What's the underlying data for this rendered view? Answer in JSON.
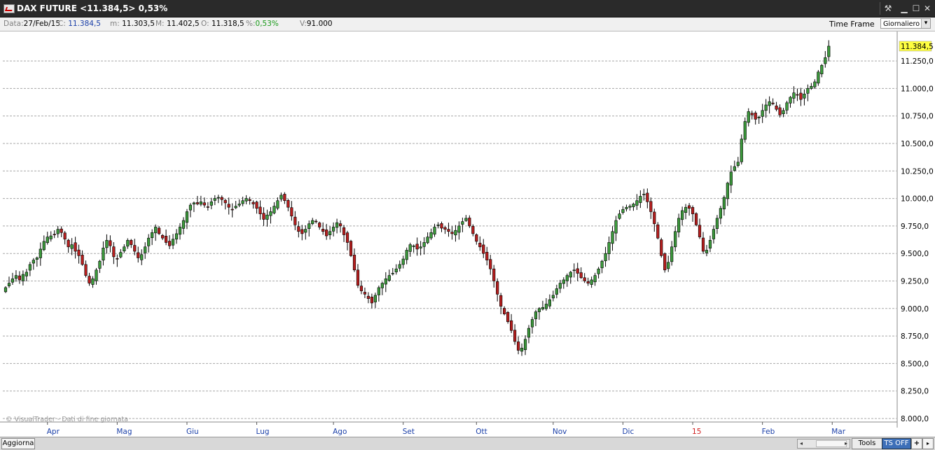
{
  "window": {
    "title": "DAX FUTURE <11.384,5> 0,53%",
    "wrench_icon": "wrench-icon",
    "min_icon": "minimize-icon",
    "max_icon": "maximize-icon",
    "close_icon": "close-icon",
    "wrench_glyph": "⚒",
    "min_glyph": "▁",
    "max_glyph": "☐",
    "close_glyph": "✕"
  },
  "infobar": {
    "data_label": "Data:",
    "data_value": "27/Feb/15",
    "close_label": "C:",
    "close_value": "11.384,5",
    "min_label": "m:",
    "min_value": "11.303,5",
    "max_label": "M:",
    "max_value": "11.402,5",
    "open_label": "O:",
    "open_value": "11.318,5",
    "pct_label": "%:",
    "pct_value": "0,53%",
    "vol_label": "V:",
    "vol_value": "91.000",
    "timeframe_label": "Time Frame",
    "timeframe_value": "Giornaliero",
    "dropdown_glyph": "▾"
  },
  "chart_data": {
    "type": "candlestick",
    "title": "DAX FUTURE",
    "ylim": [
      8000,
      11400
    ],
    "y_ticks": [
      "8.000,0",
      "8.250,0",
      "8.500,0",
      "8.750,0",
      "9.000,0",
      "9.250,0",
      "9.500,0",
      "9.750,0",
      "10.000,0",
      "10.250,0",
      "10.500,0",
      "10.750,0",
      "11.000,0",
      "11.250,0"
    ],
    "y_tick_values": [
      8000,
      8250,
      8500,
      8750,
      9000,
      9250,
      9500,
      9750,
      10000,
      10250,
      10500,
      10750,
      11000,
      11250
    ],
    "last_price_label": "11.384,5",
    "last_price": 11384.5,
    "x_months": [
      {
        "label": "Apr",
        "index": 12,
        "highlight": false
      },
      {
        "label": "Mag",
        "index": 32,
        "highlight": false
      },
      {
        "label": "Giu",
        "index": 52,
        "highlight": false
      },
      {
        "label": "Lug",
        "index": 72,
        "highlight": false
      },
      {
        "label": "Ago",
        "index": 94,
        "highlight": false
      },
      {
        "label": "Set",
        "index": 114,
        "highlight": false
      },
      {
        "label": "Ott",
        "index": 135,
        "highlight": false
      },
      {
        "label": "Nov",
        "index": 157,
        "highlight": false
      },
      {
        "label": "Dic",
        "index": 177,
        "highlight": false
      },
      {
        "label": "15",
        "index": 197,
        "highlight": true
      },
      {
        "label": "Feb",
        "index": 217,
        "highlight": false
      },
      {
        "label": "Mar",
        "index": 237,
        "highlight": false
      }
    ],
    "closes": [
      9190,
      9230,
      9270,
      9300,
      9260,
      9310,
      9330,
      9400,
      9440,
      9460,
      9540,
      9610,
      9650,
      9660,
      9670,
      9720,
      9690,
      9630,
      9560,
      9580,
      9520,
      9480,
      9400,
      9300,
      9230,
      9270,
      9350,
      9430,
      9550,
      9620,
      9570,
      9470,
      9450,
      9510,
      9560,
      9620,
      9580,
      9520,
      9460,
      9490,
      9560,
      9640,
      9690,
      9740,
      9680,
      9640,
      9600,
      9570,
      9630,
      9680,
      9740,
      9800,
      9880,
      9940,
      9960,
      9950,
      9970,
      9940,
      9920,
      9970,
      10000,
      10010,
      9990,
      9960,
      9920,
      9900,
      9930,
      9950,
      9980,
      10000,
      9980,
      9950,
      9910,
      9860,
      9810,
      9850,
      9880,
      9930,
      9980,
      10030,
      9980,
      9920,
      9840,
      9760,
      9700,
      9680,
      9720,
      9770,
      9800,
      9790,
      9740,
      9700,
      9660,
      9700,
      9740,
      9780,
      9750,
      9670,
      9600,
      9480,
      9350,
      9210,
      9160,
      9130,
      9090,
      9050,
      9120,
      9190,
      9230,
      9270,
      9300,
      9320,
      9360,
      9400,
      9450,
      9530,
      9580,
      9570,
      9540,
      9560,
      9600,
      9650,
      9690,
      9740,
      9760,
      9730,
      9720,
      9700,
      9680,
      9710,
      9750,
      9790,
      9820,
      9750,
      9680,
      9610,
      9560,
      9500,
      9440,
      9360,
      9250,
      9130,
      9020,
      8950,
      8880,
      8800,
      8700,
      8620,
      8640,
      8720,
      8820,
      8900,
      8970,
      9000,
      9010,
      9040,
      9080,
      9120,
      9180,
      9230,
      9260,
      9300,
      9330,
      9350,
      9320,
      9280,
      9250,
      9230,
      9260,
      9300,
      9360,
      9430,
      9500,
      9600,
      9700,
      9800,
      9860,
      9900,
      9920,
      9930,
      9950,
      9980,
      10020,
      10040,
      9970,
      9880,
      9770,
      9640,
      9480,
      9350,
      9420,
      9560,
      9700,
      9820,
      9890,
      9920,
      9910,
      9860,
      9760,
      9650,
      9520,
      9530,
      9620,
      9720,
      9820,
      9910,
      10010,
      10140,
      10240,
      10290,
      10330,
      10540,
      10700,
      10790,
      10760,
      10720,
      10740,
      10800,
      10850,
      10880,
      10860,
      10810,
      10760,
      10800,
      10870,
      10920,
      10960,
      10940,
      10900,
      10950,
      11000,
      11020,
      11060,
      11150,
      11210,
      11280,
      11384.5
    ]
  },
  "watermark": "© VisualTrader - Dati di fine giornata",
  "bottombar": {
    "refresh_label": "Aggiorna",
    "tools_label": "Tools",
    "tsoff_label": "TS OFF",
    "plus_label": "+",
    "menu_glyph": "▸",
    "scroll_left": "◂",
    "scroll_right": "▸"
  },
  "colors": {
    "up": "#3c9a3c",
    "down": "#b81e1e",
    "grid": "#a8a8a8",
    "last_price_bg": "#ffff40",
    "month_label": "#1a3fa8",
    "year_label": "#d02020"
  }
}
